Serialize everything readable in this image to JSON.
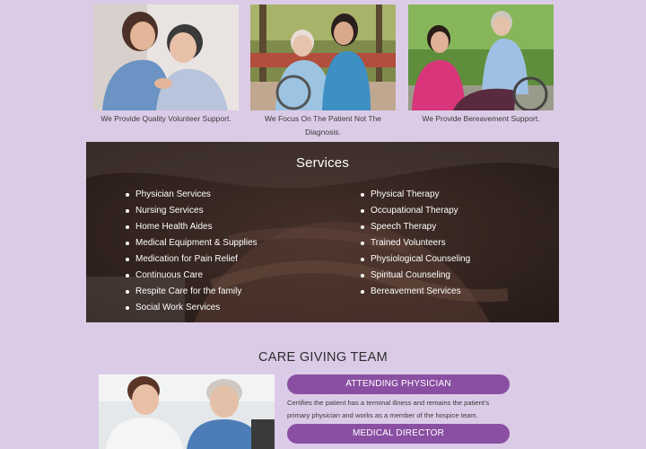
{
  "cards": [
    {
      "caption": "We Provide Quality Volunteer Support."
    },
    {
      "caption": "We Focus On The Patient Not The Diagnosis."
    },
    {
      "caption": "We Provide Bereavement Support."
    }
  ],
  "services": {
    "title": "Services",
    "left": [
      "Physician Services",
      "Nursing Services",
      "Home Health Aides",
      "Medical Equipment & Supplies",
      "Medication for Pain Relief",
      "Continuous Care",
      "Respite Care for the family",
      "Social Work Services"
    ],
    "right": [
      "Physical Therapy",
      "Occupational Therapy",
      "Speech Therapy",
      "Trained Volunteers",
      "Physiological Counseling",
      "Spiritual Counseling",
      "Bereavement Services"
    ]
  },
  "team": {
    "title": "CARE GIVING TEAM",
    "roles": [
      {
        "label": "ATTENDING PHYSICIAN",
        "description": "Certifies the patient has a terminal illness and remains the patient's primary physician and works as a member of the hospice team."
      },
      {
        "label": "MEDICAL DIRECTOR",
        "description": ""
      }
    ]
  },
  "colors": {
    "page_background": "#dccbe7",
    "accent_pill": "#8a4fa2",
    "services_panel": "#3b2a26"
  }
}
